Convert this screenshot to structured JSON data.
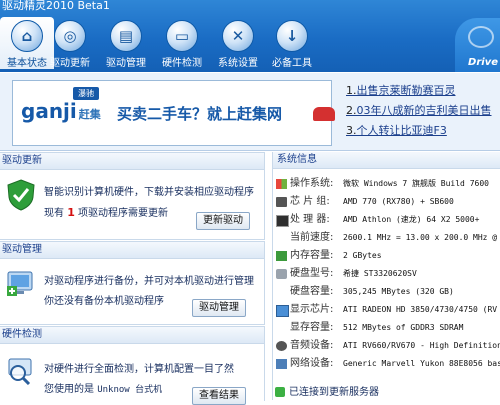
{
  "app": {
    "title": "驱动精灵2010 Beta1",
    "brand": "Drive"
  },
  "toolbar": [
    {
      "label": "基本状态",
      "icon": "home-icon",
      "glyph": "⌂",
      "active": true
    },
    {
      "label": "驱动更新",
      "icon": "globe-icon",
      "glyph": "◎"
    },
    {
      "label": "驱动管理",
      "icon": "folder-icon",
      "glyph": "▤"
    },
    {
      "label": "硬件检测",
      "icon": "monitor-icon",
      "glyph": "▭"
    },
    {
      "label": "系统设置",
      "icon": "tools-icon",
      "glyph": "✕"
    },
    {
      "label": "必备工具",
      "icon": "download-icon",
      "glyph": "↓"
    }
  ],
  "banner": {
    "ad": {
      "logo": "ganji",
      "logo_sub": "赶集",
      "tag": "瀑驰",
      "slogan": "买卖二手车？就上赶集网"
    },
    "links": [
      {
        "num": "1.",
        "text": "出售京莱断勒赛百灵"
      },
      {
        "num": "2.",
        "text": "03年八成新的吉利美日出售"
      },
      {
        "num": "3.",
        "text": "个人转让比亚迪F3"
      }
    ]
  },
  "driver_update": {
    "header": "驱动更新",
    "line1": "智能识别计算机硬件，下载并安装相应驱动程序",
    "line2_prefix": "现有",
    "count": "1",
    "line2_suffix": "项驱动程序需要更新",
    "button": "更新驱动"
  },
  "driver_manage": {
    "header": "驱动管理",
    "line1": "对驱动程序进行备份，并可对本机驱动进行管理",
    "line2": "你还没有备份本机驱动程序",
    "button": "驱动管理"
  },
  "hardware_check": {
    "header": "硬件检测",
    "line1": "对硬件进行全面检测，计算机配置一目了然",
    "line2_prefix": "您使用的是",
    "line2_value": "Unknow 台式机",
    "button": "查看结果"
  },
  "system_info": {
    "header": "系统信息",
    "rows": [
      {
        "label": "操作系统:",
        "value": "微软 Windows 7 旗舰版 Build 7600",
        "icon": "windows-icon"
      },
      {
        "label": "芯 片 组:",
        "value": "AMD 770 (RX780) + SB600",
        "icon": "chipset-icon"
      },
      {
        "label": "处 理 器:",
        "value": "AMD Athlon (速龙) 64 X2 5000+",
        "icon": "cpu-icon"
      },
      {
        "label": "当前速度:",
        "value": "2600.1 MHz = 13.00 x 200.0 MHz @",
        "icon": ""
      },
      {
        "label": "内存容量:",
        "value": "2 GBytes",
        "icon": "memory-icon"
      },
      {
        "label": "硬盘型号:",
        "value": "希捷 ST3320620SV",
        "icon": "disk-icon"
      },
      {
        "label": "硬盘容量:",
        "value": "305,245 MBytes (320 GB)",
        "icon": ""
      },
      {
        "label": "显示芯片:",
        "value": "ATI RADEON HD 3850/4730/4750 (RV",
        "icon": "display-icon"
      },
      {
        "label": "显存容量:",
        "value": "512 MBytes of GDDR3 SDRAM",
        "icon": ""
      },
      {
        "label": "音频设备:",
        "value": "ATI RV660/RV670 - High Definition",
        "icon": "audio-icon"
      },
      {
        "label": "网络设备:",
        "value": "Generic Marvell Yukon 88E8056 bas",
        "icon": "network-icon"
      }
    ],
    "status": "已连接到更新服务器"
  }
}
